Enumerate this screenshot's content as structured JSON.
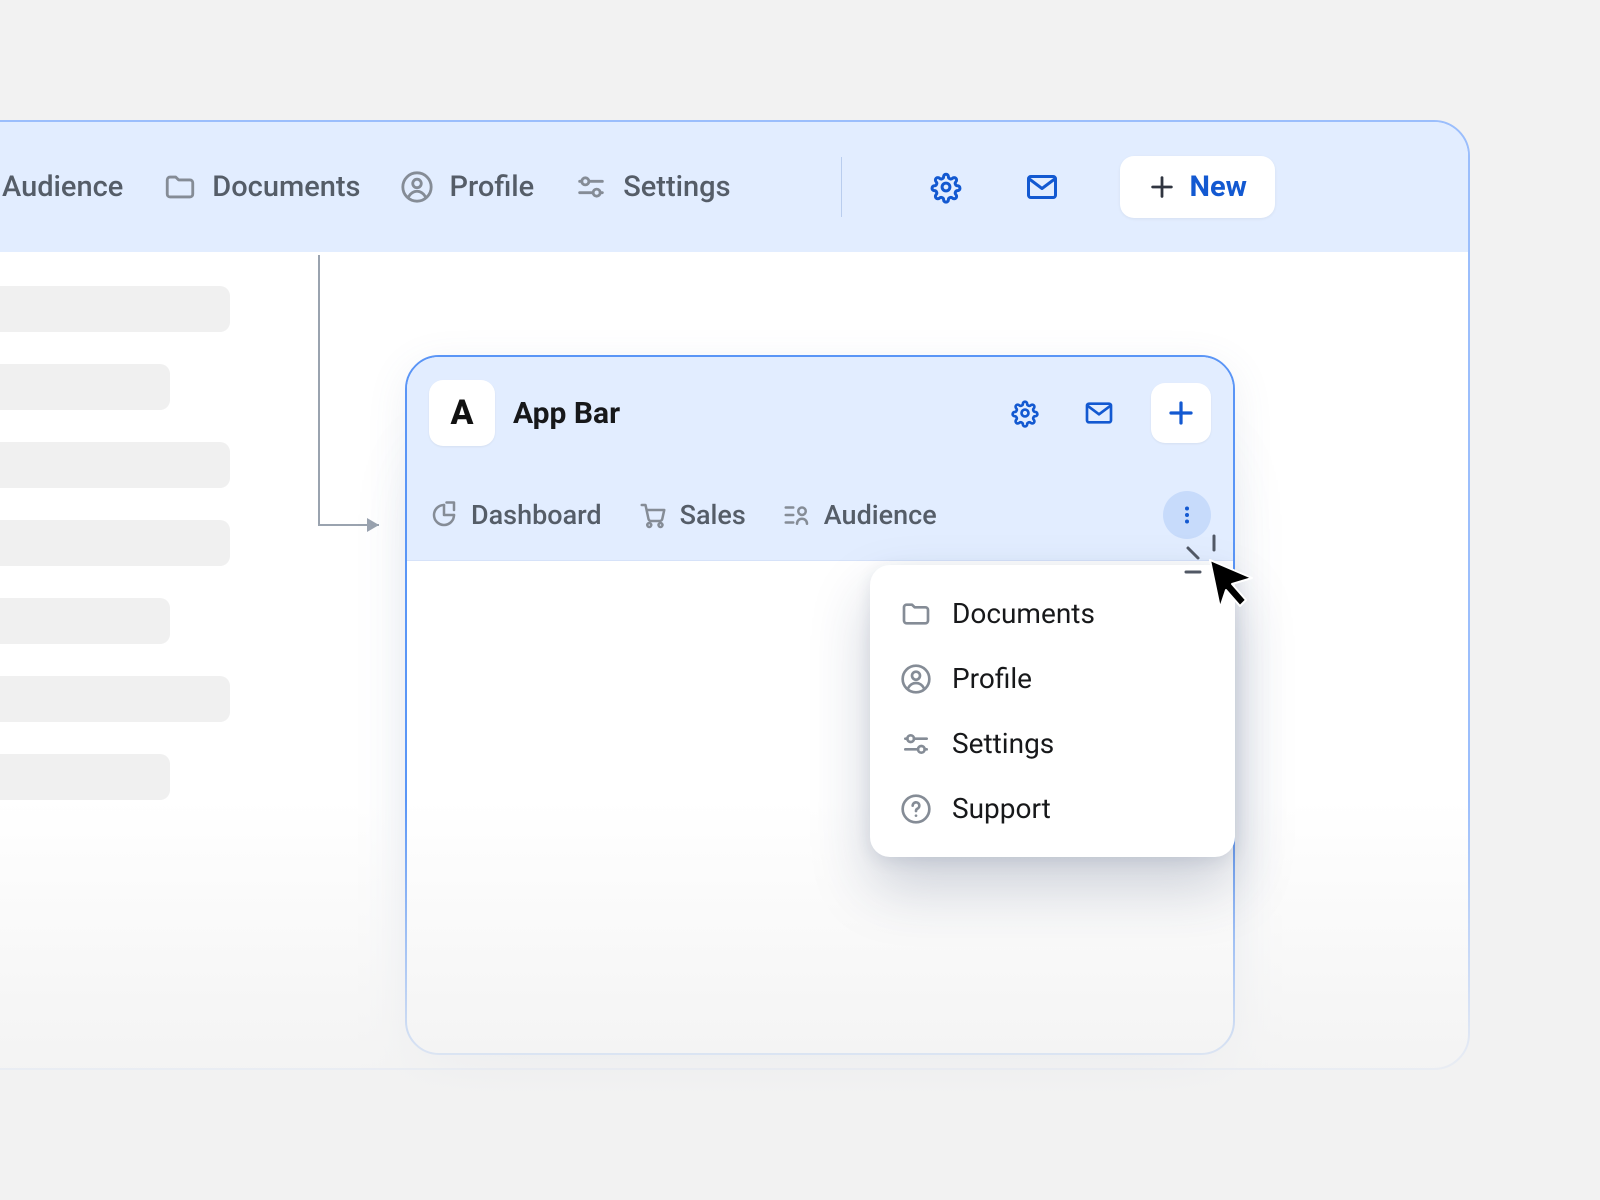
{
  "back": {
    "nav": {
      "audience": "Audience",
      "documents": "Documents",
      "profile": "Profile",
      "settings": "Settings"
    },
    "new_label": "New"
  },
  "front": {
    "logo_letter": "A",
    "title": "App Bar",
    "tabs": {
      "dashboard": "Dashboard",
      "sales": "Sales",
      "audience": "Audience"
    }
  },
  "dropdown": {
    "documents": "Documents",
    "profile": "Profile",
    "settings": "Settings",
    "support": "Support"
  }
}
